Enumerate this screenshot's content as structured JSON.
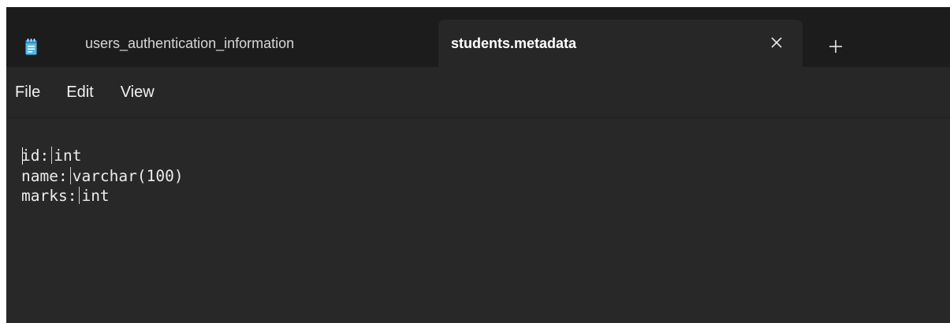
{
  "tabs": [
    {
      "label": "users_authentication_information",
      "active": false
    },
    {
      "label": "students.metadata",
      "active": true
    }
  ],
  "tab_close_glyph": "✕",
  "new_tab_glyph": "+",
  "menu": {
    "file": "File",
    "edit": "Edit",
    "view": "View"
  },
  "editor": {
    "lines": [
      {
        "key": "id:",
        "type": "int"
      },
      {
        "key": "name:",
        "type": "varchar(100)"
      },
      {
        "key": "marks:",
        "type": "int"
      }
    ]
  },
  "icons": {
    "app": "notepad-icon",
    "close": "close-icon",
    "new_tab": "plus-icon"
  },
  "colors": {
    "tabbar_bg": "#1c1c1c",
    "window_bg": "#272727",
    "text": "#ececec",
    "notepad_icon_blue": "#4fb6e6"
  }
}
